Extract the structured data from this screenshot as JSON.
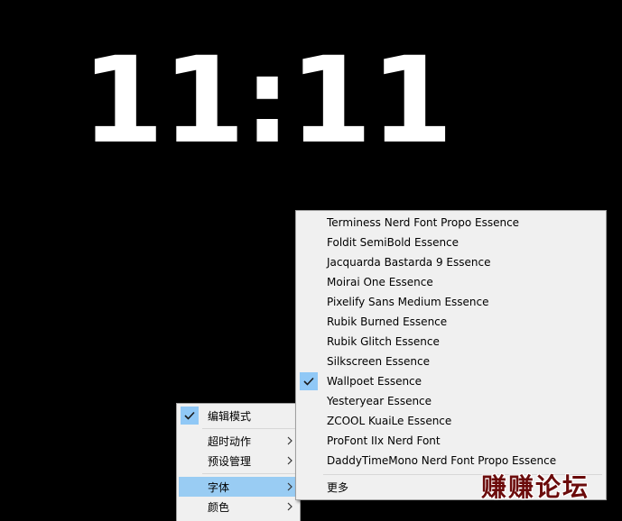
{
  "clock": {
    "time": "11:11"
  },
  "main_menu": {
    "items": [
      {
        "label": "编辑模式",
        "checked": true,
        "submenu": false
      },
      {
        "label": "超时动作",
        "checked": false,
        "submenu": true
      },
      {
        "label": "预设管理",
        "checked": false,
        "submenu": true
      },
      {
        "label": "字体",
        "checked": false,
        "submenu": true,
        "highlighted": true
      },
      {
        "label": "颜色",
        "checked": false,
        "submenu": true
      }
    ]
  },
  "font_menu": {
    "items": [
      {
        "label": "Terminess Nerd Font Propo Essence",
        "checked": false
      },
      {
        "label": "Foldit SemiBold Essence",
        "checked": false
      },
      {
        "label": "Jacquarda Bastarda 9 Essence",
        "checked": false
      },
      {
        "label": "Moirai One Essence",
        "checked": false
      },
      {
        "label": "Pixelify Sans Medium Essence",
        "checked": false
      },
      {
        "label": "Rubik Burned Essence",
        "checked": false
      },
      {
        "label": "Rubik Glitch Essence",
        "checked": false
      },
      {
        "label": "Silkscreen Essence",
        "checked": false
      },
      {
        "label": "Wallpoet Essence",
        "checked": true
      },
      {
        "label": "Yesteryear Essence",
        "checked": false
      },
      {
        "label": "ZCOOL KuaiLe Essence",
        "checked": false
      },
      {
        "label": "ProFont IIx Nerd Font",
        "checked": false
      },
      {
        "label": "DaddyTimeMono Nerd Font Propo Essence",
        "checked": false
      }
    ],
    "more_label": "更多"
  },
  "watermark": {
    "text": "赚赚论坛"
  },
  "colors": {
    "menu_background": "#f0f0f0",
    "highlight": "#99ccf3",
    "check_background": "#90c8f6",
    "clock_text": "#ffffff",
    "watermark_text": "#6b0b0b"
  }
}
